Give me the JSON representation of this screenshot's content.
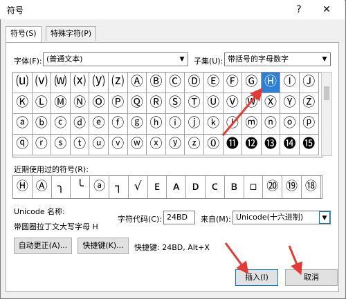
{
  "window": {
    "title": "符号",
    "help": "?",
    "close": "✕"
  },
  "tabs": [
    {
      "label": "符号(S)"
    },
    {
      "label": "特殊字符(P)"
    }
  ],
  "font": {
    "label": "字体(F):",
    "value": "(普通文本)"
  },
  "subset": {
    "label": "子集(U):",
    "value": "带括号的字母数字"
  },
  "symbols": [
    "⒰",
    "⒱",
    "⒲",
    "⒳",
    "⒴",
    "⒵",
    "Ⓐ",
    "Ⓑ",
    "Ⓒ",
    "Ⓓ",
    "Ⓔ",
    "Ⓕ",
    "Ⓖ",
    "Ⓗ",
    "Ⓘ",
    "Ⓙ",
    "Ⓚ",
    "Ⓛ",
    "Ⓜ",
    "Ⓝ",
    "Ⓞ",
    "Ⓟ",
    "Ⓠ",
    "Ⓡ",
    "Ⓢ",
    "Ⓣ",
    "Ⓤ",
    "Ⓥ",
    "Ⓦ",
    "Ⓧ",
    "Ⓨ",
    "Ⓩ",
    "ⓐ",
    "ⓑ",
    "ⓒ",
    "ⓓ",
    "ⓔ",
    "ⓕ",
    "ⓖ",
    "ⓗ",
    "ⓘ",
    "ⓙ",
    "ⓚ",
    "ⓛ",
    "ⓜ",
    "ⓝ",
    "ⓞ",
    "ⓟ",
    "ⓠ",
    "ⓡ",
    "ⓢ",
    "ⓣ",
    "ⓤ",
    "ⓥ",
    "ⓦ",
    "ⓧ",
    "ⓨ",
    "ⓩ",
    "⓪",
    "⓫",
    "⓬",
    "⓭",
    "⓮",
    "⓯"
  ],
  "selected_symbol": "Ⓗ",
  "recent": {
    "label": "近期使用过的符号(R):",
    "items": [
      "Ⓗ",
      "Ⓐ",
      "╮",
      "╰",
      "ⓐ",
      "┐",
      "√",
      "ᴇ",
      "ᴀ",
      "ᴅ",
      "ᴄ",
      "ʙ",
      "▫",
      "⑳",
      "⑲",
      "⑱"
    ]
  },
  "unicode_name": {
    "label": "Unicode 名称:",
    "value": "带圆圈拉丁文大写字母 H"
  },
  "char_code": {
    "label": "字符代码(C):",
    "value": "24BD"
  },
  "from": {
    "label": "来自(M):",
    "value": "Unicode(十六进制)"
  },
  "buttons": {
    "autocorrect": "自动更正(A)...",
    "shortcut_key": "快捷键(K)...",
    "shortcut_text": "快捷键: 24BD, Alt+X",
    "insert": "插入(I)",
    "cancel": "取消"
  },
  "colors": {
    "accent": "#2e7fd6",
    "annotation": "#e53935"
  }
}
